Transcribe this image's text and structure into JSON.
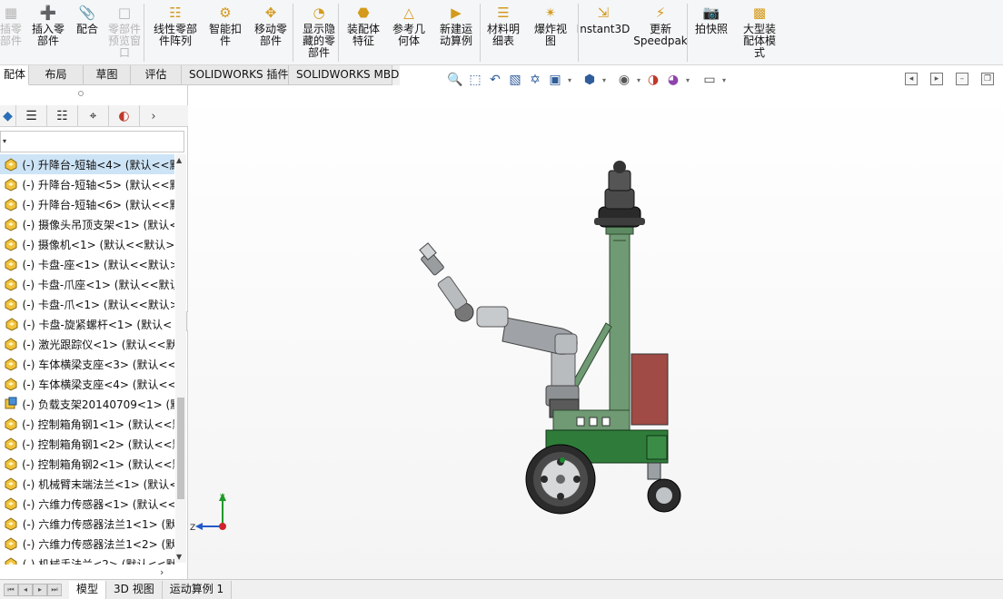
{
  "ribbon": {
    "buttons": [
      {
        "label": "插零\n部件",
        "icon": "component-icon",
        "disabled": true
      },
      {
        "label": "插入零\n部件",
        "icon": "insert-component-icon",
        "disabled": false
      },
      {
        "label": "配合",
        "icon": "mate-icon",
        "disabled": false
      },
      {
        "label": "零部件\n预览窗\n口",
        "icon": "preview-window-icon",
        "disabled": true
      },
      {
        "label": "线性零部\n件阵列",
        "icon": "linear-pattern-icon",
        "disabled": false
      },
      {
        "label": "智能扣\n件",
        "icon": "smart-fastener-icon",
        "disabled": false
      },
      {
        "label": "移动零\n部件",
        "icon": "move-component-icon",
        "disabled": false
      },
      {
        "label": "显示隐\n藏的零\n部件",
        "icon": "show-hidden-icon",
        "disabled": false
      },
      {
        "label": "装配体\n特征",
        "icon": "assembly-feature-icon",
        "disabled": false
      },
      {
        "label": "参考几\n何体",
        "icon": "reference-geometry-icon",
        "disabled": false
      },
      {
        "label": "新建运\n动算例",
        "icon": "motion-study-icon",
        "disabled": false
      },
      {
        "label": "材料明\n细表",
        "icon": "bom-icon",
        "disabled": false
      },
      {
        "label": "爆炸视\n图",
        "icon": "exploded-view-icon",
        "disabled": false
      },
      {
        "label": "Instant3D",
        "icon": "instant3d-icon",
        "disabled": false
      },
      {
        "label": "更新\nSpeedpak",
        "icon": "speedpak-icon",
        "disabled": false
      },
      {
        "label": "拍快照",
        "icon": "snapshot-icon",
        "disabled": false
      },
      {
        "label": "大型装\n配体模\n式",
        "icon": "large-assembly-icon",
        "disabled": false
      }
    ]
  },
  "command_tabs": [
    "配体",
    "布局",
    "草图",
    "评估",
    "SOLIDWORKS 插件",
    "SOLIDWORKS MBD"
  ],
  "feature_tree": {
    "items": [
      {
        "label": "(-) 升降台-短轴<4> (默认<<默",
        "icon": "part-icon",
        "selected": true
      },
      {
        "label": "(-) 升降台-短轴<5> (默认<<默",
        "icon": "part-icon",
        "selected": false
      },
      {
        "label": "(-) 升降台-短轴<6> (默认<<默",
        "icon": "part-icon",
        "selected": false
      },
      {
        "label": "(-) 摄像头吊顶支架<1> (默认<",
        "icon": "part-icon",
        "selected": false
      },
      {
        "label": "(-) 摄像机<1> (默认<<默认>_",
        "icon": "part-icon",
        "selected": false
      },
      {
        "label": "(-) 卡盘-座<1> (默认<<默认>",
        "icon": "part-icon",
        "selected": false
      },
      {
        "label": "(-) 卡盘-爪座<1> (默认<<默认",
        "icon": "part-icon",
        "selected": false
      },
      {
        "label": "(-) 卡盘-爪<1> (默认<<默认>",
        "icon": "part-icon",
        "selected": false
      },
      {
        "label": "(-) 卡盘-旋紧螺杆<1> (默认<",
        "icon": "part-icon",
        "selected": false
      },
      {
        "label": "(-) 激光跟踪仪<1> (默认<<默",
        "icon": "part-icon",
        "selected": false
      },
      {
        "label": "(-) 车体横梁支座<3> (默认<<",
        "icon": "part-icon",
        "selected": false
      },
      {
        "label": "(-) 车体横梁支座<4> (默认<<",
        "icon": "part-icon",
        "selected": false
      },
      {
        "label": "(-) 负载支架20140709<1> (默",
        "icon": "assembly-icon",
        "selected": false
      },
      {
        "label": "(-) 控制箱角钢1<1> (默认<<默",
        "icon": "part-icon",
        "selected": false
      },
      {
        "label": "(-) 控制箱角钢1<2> (默认<<默",
        "icon": "part-icon",
        "selected": false
      },
      {
        "label": "(-) 控制箱角钢2<1> (默认<<默",
        "icon": "part-icon",
        "selected": false
      },
      {
        "label": "(-) 机械臂末端法兰<1> (默认<",
        "icon": "part-icon",
        "selected": false
      },
      {
        "label": "(-) 六维力传感器<1> (默认<<",
        "icon": "part-icon",
        "selected": false
      },
      {
        "label": "(-) 六维力传感器法兰1<1> (默",
        "icon": "part-icon",
        "selected": false
      },
      {
        "label": "(-) 六维力传感器法兰1<2> (默",
        "icon": "part-icon",
        "selected": false
      },
      {
        "label": "(-) 机械手法兰<2> (默认<<默",
        "icon": "part-icon",
        "selected": false
      }
    ]
  },
  "triad": {
    "y_label": "Y",
    "z_label": "Z"
  },
  "bottom_tabs": [
    "模型",
    "3D 视图",
    "运动算例 1"
  ],
  "colors": {
    "arm_gray": "#b9bcbf",
    "mast_green": "#6f9a73",
    "base_green": "#2f7c3a",
    "control_box_red": "#a04b45",
    "selected_row": "#cde4f7",
    "part_icon_yellow": "#f2c23a"
  }
}
